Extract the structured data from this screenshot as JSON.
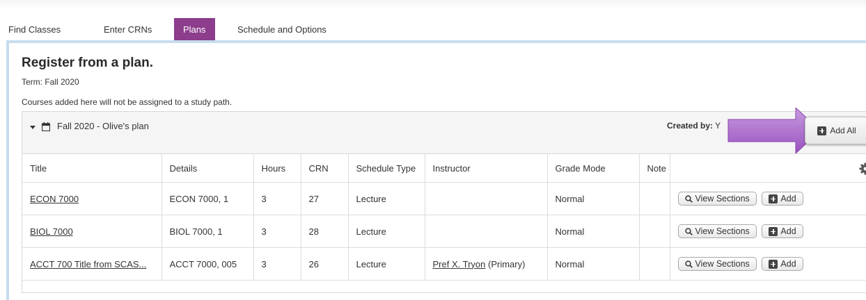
{
  "tabs": [
    {
      "label": "Find Classes"
    },
    {
      "label": "Enter CRNs"
    },
    {
      "label": "Plans",
      "active": true
    },
    {
      "label": "Schedule and Options"
    }
  ],
  "panel": {
    "title": "Register from a plan.",
    "term": "Term: Fall 2020",
    "note": "Courses added here will not be assigned to a study path."
  },
  "plan": {
    "name": "Fall 2020 - Olive's plan",
    "created_by_label": "Created by:",
    "created_by_value": "Y",
    "add_all_label": "Add All"
  },
  "table": {
    "columns": [
      "Title",
      "Details",
      "Hours",
      "CRN",
      "Schedule Type",
      "Instructor",
      "Grade Mode",
      "Note",
      ""
    ],
    "rows": [
      {
        "title": "ECON 7000",
        "details": "ECON 7000, 1",
        "hours": "3",
        "crn": "27",
        "schedule_type": "Lecture",
        "instructor_name": "",
        "instructor_role": "",
        "grade_mode": "Normal",
        "note": ""
      },
      {
        "title": "BIOL 7000",
        "details": "BIOL 7000, 1",
        "hours": "3",
        "crn": "28",
        "schedule_type": "Lecture",
        "instructor_name": "",
        "instructor_role": "",
        "grade_mode": "Normal",
        "note": ""
      },
      {
        "title": "ACCT 700 Title from SCAS...",
        "details": "ACCT 7000, 005",
        "hours": "3",
        "crn": "26",
        "schedule_type": "Lecture",
        "instructor_name": "Pref X. Tryon",
        "instructor_role": "(Primary)",
        "grade_mode": "Normal",
        "note": ""
      }
    ],
    "view_sections_label": "View Sections",
    "add_label": "Add"
  },
  "colors": {
    "active_tab": "#8c3d8c",
    "panel_border": "#c6dcef",
    "arrow": "#a35ec4"
  },
  "icons": {
    "caret": "caret-down-icon",
    "calendar": "calendar-icon",
    "gear": "gear-icon",
    "search": "search-icon",
    "plus": "plus-square-icon",
    "arrow": "arrow-right-icon"
  }
}
